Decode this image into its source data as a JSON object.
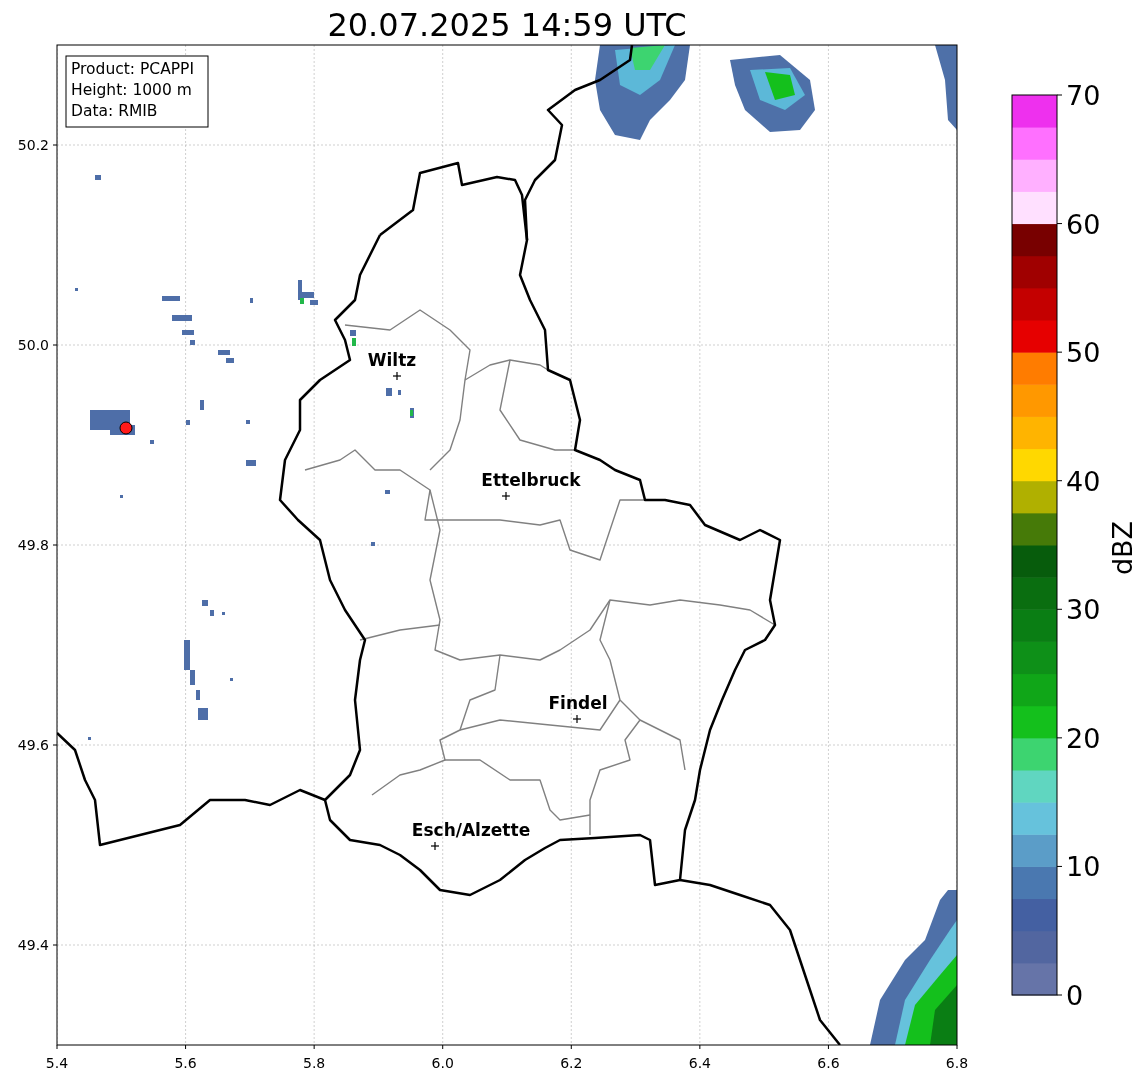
{
  "title": "20.07.2025 14:59 UTC",
  "info": [
    "Product: PCAPPI",
    "Height: 1000 m",
    "Data: RMIB"
  ],
  "x_axis": {
    "ticks": [
      "5.4",
      "5.6",
      "5.8",
      "6.0",
      "6.2",
      "6.4",
      "6.6",
      "6.8"
    ]
  },
  "y_axis": {
    "ticks": [
      "50.2",
      "50.0",
      "49.8",
      "49.6",
      "49.4"
    ]
  },
  "cities": [
    {
      "name": "Wiltz"
    },
    {
      "name": "Ettelbruck"
    },
    {
      "name": "Findel"
    },
    {
      "name": "Esch/Alzette"
    }
  ],
  "colorbar": {
    "label": "dBZ",
    "ticks": [
      "70",
      "60",
      "50",
      "40",
      "30",
      "20",
      "10",
      "0"
    ],
    "bins": [
      {
        "color": "#6674a8"
      },
      {
        "color": "#5266a0"
      },
      {
        "color": "#4460a2"
      },
      {
        "color": "#4a78b0"
      },
      {
        "color": "#5b9dc8"
      },
      {
        "color": "#66c2dc"
      },
      {
        "color": "#60d6c0"
      },
      {
        "color": "#3dd470"
      },
      {
        "color": "#14c01c"
      },
      {
        "color": "#10a618"
      },
      {
        "color": "#0e9018"
      },
      {
        "color": "#0a7e14"
      },
      {
        "color": "#0a6e10"
      },
      {
        "color": "#075c0c"
      },
      {
        "color": "#467a08"
      },
      {
        "color": "#b0b000"
      },
      {
        "color": "#ffd800"
      },
      {
        "color": "#ffb400"
      },
      {
        "color": "#ff9800"
      },
      {
        "color": "#ff7c00"
      },
      {
        "color": "#e60000"
      },
      {
        "color": "#c40000"
      },
      {
        "color": "#a00000"
      },
      {
        "color": "#780000"
      },
      {
        "color": "#ffe0ff"
      },
      {
        "color": "#ffb0ff"
      },
      {
        "color": "#ff70ff"
      },
      {
        "color": "#ee30ee"
      }
    ]
  }
}
